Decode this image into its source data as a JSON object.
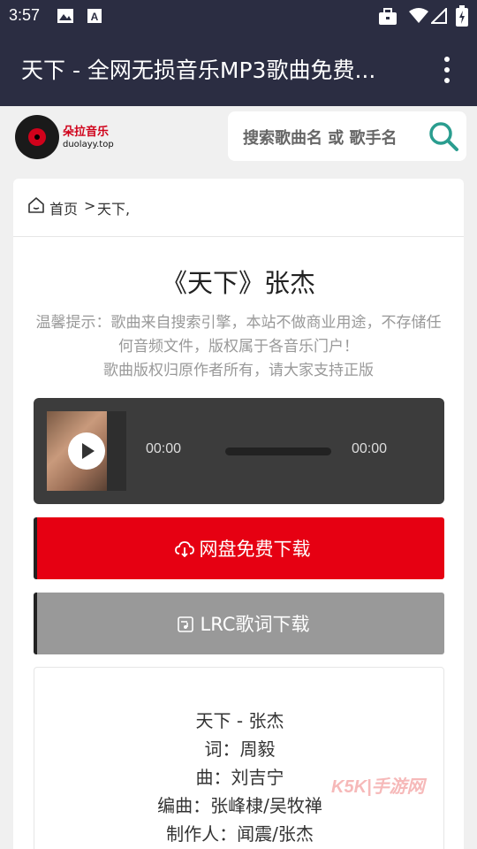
{
  "status_bar": {
    "time": "3:57"
  },
  "app_bar": {
    "title": "天下 - 全网无损音乐MP3歌曲免费..."
  },
  "site": {
    "brand": "朵拉音乐",
    "domain": "duolayy.top"
  },
  "search": {
    "placeholder": "搜索歌曲名 或 歌手名"
  },
  "breadcrumb": {
    "home": "首页",
    "separator": ">",
    "current": "天下,"
  },
  "song": {
    "title": "《天下》张杰"
  },
  "notice": {
    "line1": "温馨提示：歌曲来自搜索引擎，本站不做商业用途，不存储任何音频文件，版权属于各音乐门户！",
    "line2": "歌曲版权归原作者所有，请大家支持正版"
  },
  "player": {
    "current_time": "00:00",
    "duration": "00:00",
    "progress": 0
  },
  "buttons": {
    "download": "网盘免费下载",
    "lrc": "LRC歌词下载"
  },
  "lyrics": {
    "lines": [
      "天下 - 张杰",
      "词：周毅",
      "曲：刘吉宁",
      "编曲：张峰棣/吴牧禅",
      "制作人：闻震/张杰"
    ]
  },
  "watermark": {
    "text": "K5K|手游网"
  },
  "colors": {
    "header_bg": "#2b2d42",
    "download_red": "#e60012",
    "lrc_gray": "#999999",
    "search_icon": "#2a9d8f"
  }
}
